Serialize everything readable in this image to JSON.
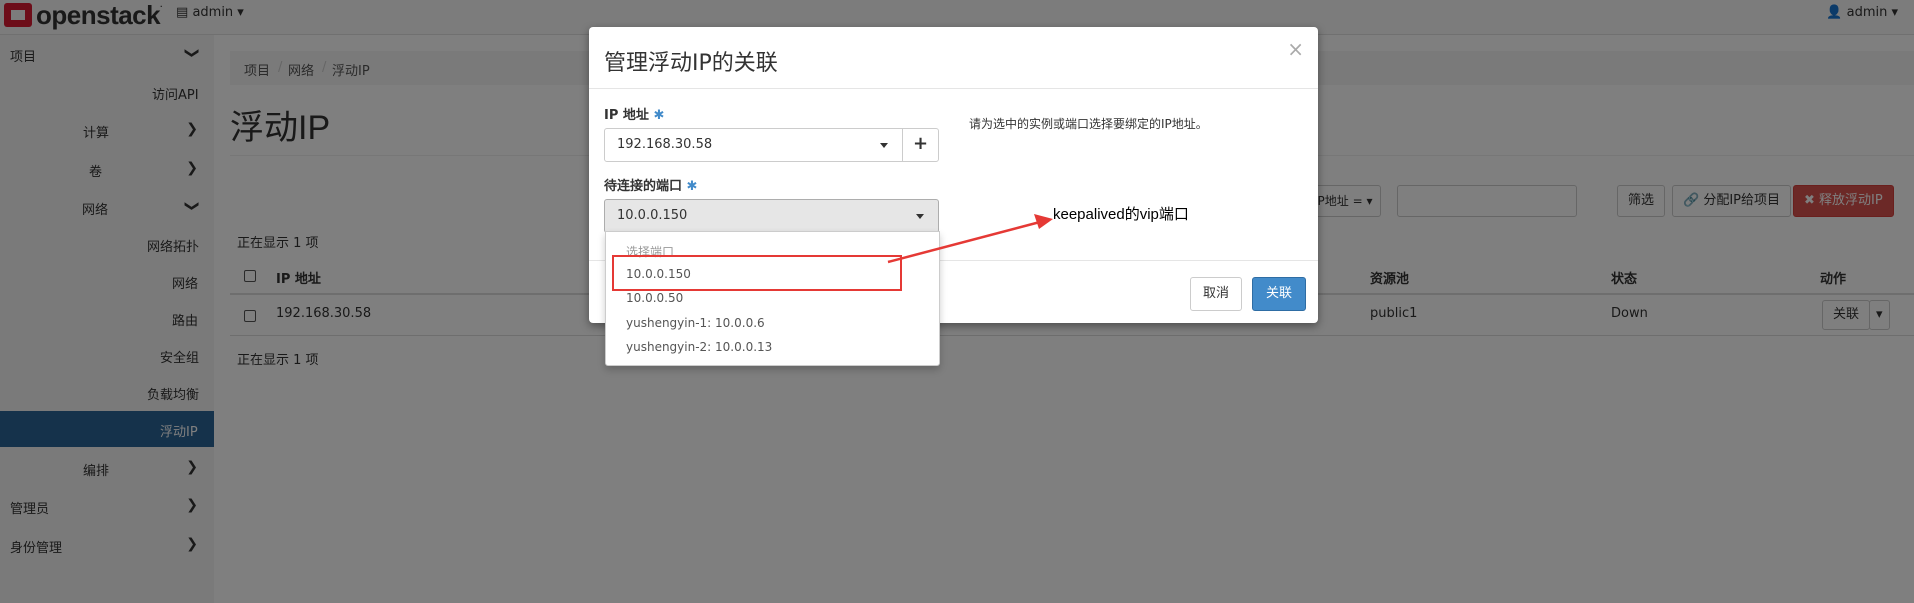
{
  "topbar": {
    "logo_text": "openstack",
    "logo_tm": ".",
    "project_menu": "admin ▾",
    "user_menu": "admin ▾"
  },
  "sidebar": {
    "items": [
      {
        "label": "项目",
        "chevron": "❯"
      },
      {
        "label": "访问API"
      },
      {
        "label": "计算",
        "chevron": "❯"
      },
      {
        "label": "卷",
        "chevron": "❯"
      },
      {
        "label": "网络",
        "chevron": "❯"
      },
      {
        "label": "网络拓扑"
      },
      {
        "label": "网络"
      },
      {
        "label": "路由"
      },
      {
        "label": "安全组"
      },
      {
        "label": "负载均衡"
      },
      {
        "label": "浮动IP"
      },
      {
        "label": "编排",
        "chevron": "❯"
      },
      {
        "label": "管理员",
        "chevron": "❯"
      },
      {
        "label": "身份管理",
        "chevron": "❯"
      }
    ]
  },
  "breadcrumb": [
    "项目",
    "网络",
    "浮动IP"
  ],
  "breadcrumb_sep": "/",
  "page": {
    "title": "浮动IP",
    "count_top": "正在显示 1 项",
    "count_bottom": "正在显示 1 项"
  },
  "toolbar": {
    "filter_select": "IP地址 = ▾",
    "filter_button": "筛选",
    "allocate_button": "🔗 分配IP给项目",
    "release_button": "✖ 释放浮动IP"
  },
  "table": {
    "headers": [
      "IP 地址",
      "资源池",
      "状态",
      "动作"
    ],
    "rows": [
      {
        "ip": "192.168.30.58",
        "pool": "public1",
        "status": "Down",
        "action": "关联"
      }
    ]
  },
  "modal": {
    "title": "管理浮动IP的关联",
    "close": "×",
    "ip_label": "IP 地址",
    "ip_value": "192.168.30.58",
    "plus": "+",
    "port_label": "待连接的端口",
    "port_value": "10.0.0.150",
    "required": "✱",
    "help": "请为选中的实例或端口选择要绑定的IP地址。",
    "cancel": "取消",
    "associate": "关联"
  },
  "dropdown": {
    "options": [
      "选择端口",
      "10.0.0.150",
      "10.0.0.50",
      "yushengyin-1: 10.0.0.6",
      "yushengyin-2: 10.0.0.13"
    ]
  },
  "annotation": {
    "text": "keepalived的vip端口",
    "color": "#e53935"
  }
}
